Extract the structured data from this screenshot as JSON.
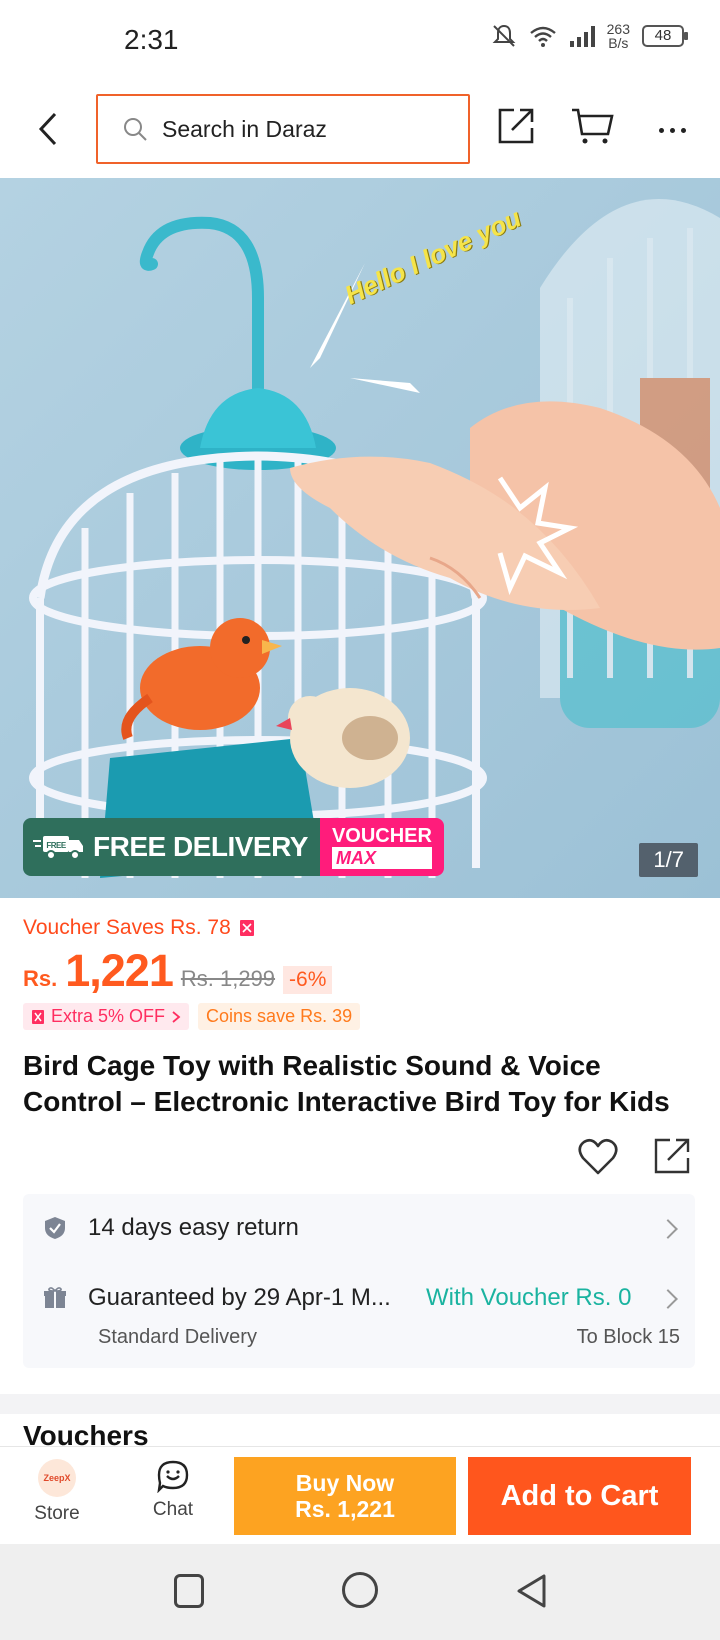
{
  "status_bar": {
    "time": "2:31",
    "net_speed_value": "263",
    "net_speed_unit": "B/s",
    "battery": "48"
  },
  "header": {
    "search_placeholder": "Search in Daraz"
  },
  "hero": {
    "overlay_text": "Hello I love you",
    "free_delivery_tag": "FREE",
    "free_delivery_label": "FREE DELIVERY",
    "voucher_label": "VOUCHER",
    "voucher_max": "MAX",
    "image_counter": "1/7"
  },
  "pricing": {
    "voucher_saves": "Voucher Saves Rs. 78",
    "currency": "Rs.",
    "price": "1,221",
    "old_price": "Rs. 1,299",
    "discount": "-6%",
    "extra_off": "Extra 5% OFF",
    "coins_save": "Coins save Rs. 39"
  },
  "product": {
    "title": "Bird Cage Toy with Realistic Sound & Voice Control – Electronic Interactive Bird Toy for Kids"
  },
  "delivery": {
    "return_label": "14 days easy return",
    "guarantee_label": "Guaranteed by 29 Apr-1 M...",
    "voucher_text": "With Voucher Rs. 0",
    "delivery_type": "Standard Delivery",
    "destination": "To Block 15"
  },
  "next_section_partial": "Vouchers",
  "action_bar": {
    "store_label": "Store",
    "store_logo_text": "ZeepX",
    "chat_label": "Chat",
    "buy_now_label": "Buy Now",
    "buy_now_price": "Rs. 1,221",
    "add_to_cart_label": "Add to Cart"
  },
  "colors": {
    "accent_orange": "#ff561d",
    "buy_now": "#fda321",
    "voucher_teal": "#1ab3a0",
    "search_border": "#f0622a"
  }
}
